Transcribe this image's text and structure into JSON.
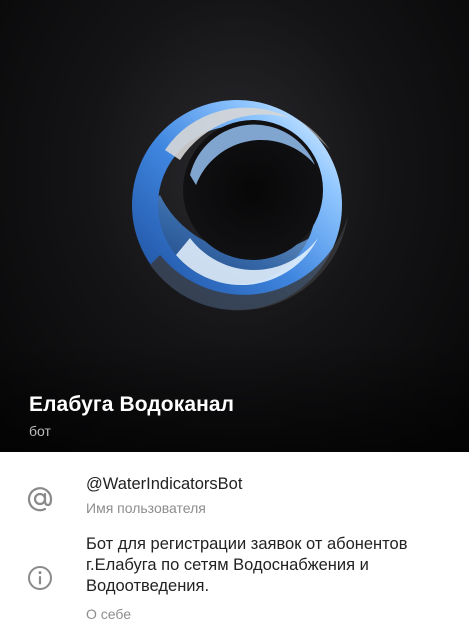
{
  "profile": {
    "name": "Елабуга Водоканал",
    "status": "бот"
  },
  "username": {
    "value": "@WaterIndicatorsBot",
    "label": "Имя пользователя",
    "icon": "at-sign-icon"
  },
  "about": {
    "text": "Бот для регистрации заявок от абонентов г.Елабуга по сетям Водоснабжения и Водоотведения.",
    "label": "О себе",
    "icon": "info-icon"
  },
  "colors": {
    "header_background": "#0b0b0c",
    "logo_blue": "#5b9bea",
    "logo_light_blue": "#a9d3ff",
    "primary_text": "#222222",
    "secondary_text": "#8d8d8d"
  }
}
